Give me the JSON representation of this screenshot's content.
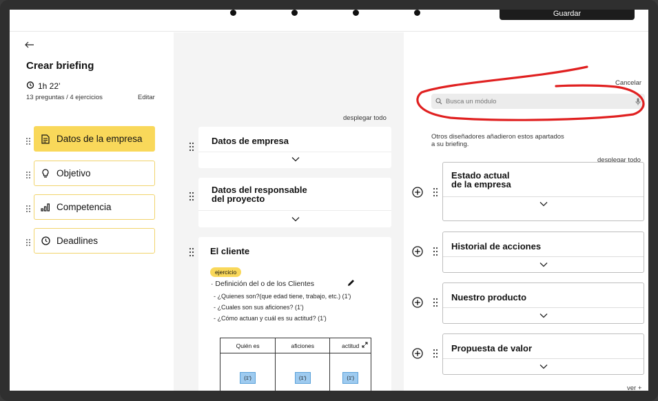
{
  "topbar": {
    "save_label": "Guardar"
  },
  "left": {
    "title": "Crear briefing",
    "duration": "1h 22’",
    "meta": "13 preguntas / 4 ejercicios",
    "edit_label": "Editar",
    "nav": [
      {
        "label": "Datos de la empresa",
        "icon": "document-icon",
        "active": true
      },
      {
        "label": "Objetivo",
        "icon": "lightbulb-icon"
      },
      {
        "label": "Competencia",
        "icon": "bar-chart-icon"
      },
      {
        "label": "Deadlines",
        "icon": "clock-icon"
      }
    ]
  },
  "middle": {
    "expand_all": "desplegar todo",
    "cards": [
      {
        "title": "Datos de empresa"
      },
      {
        "title": "Datos del responsable del proyecto",
        "title_line1": "Datos del responsable",
        "title_line2": "del proyecto"
      },
      {
        "title": "El cliente",
        "badge": "ejercicio",
        "exercise_title": "Definición del o de los Clientes",
        "questions": [
          "- ¿Quienes son?(que edad tiene, trabajo, etc.) (1')",
          "- ¿Cuales son sus aficiones? (1')",
          "- ¿Cómo actuan y cuál es su actitud? (1')"
        ],
        "table_headers": [
          "Quién es",
          "aficiones",
          "actitud"
        ],
        "table_cells": [
          "(1')",
          "(1')",
          "(1')"
        ]
      }
    ]
  },
  "right": {
    "cancel_label": "Cancelar",
    "search_placeholder": "Busca un módulo",
    "suggestion_text_line1": "Otros diseñadores añadieron estos apartados",
    "suggestion_text_line2": "a su briefing.",
    "expand_all": "desplegar todo",
    "modules": [
      {
        "title_line1": "Estado actual",
        "title_line2": "de la empresa"
      },
      {
        "title_line1": "Historial de acciones",
        "title_line2": ""
      },
      {
        "title_line1": "Nuestro producto",
        "title_line2": ""
      },
      {
        "title_line1": "Propuesta de valor",
        "title_line2": ""
      }
    ],
    "see_more": "ver +"
  },
  "colors": {
    "accent": "#f9d85a",
    "annotation": "#e02020",
    "dark": "#1c1c1c"
  }
}
